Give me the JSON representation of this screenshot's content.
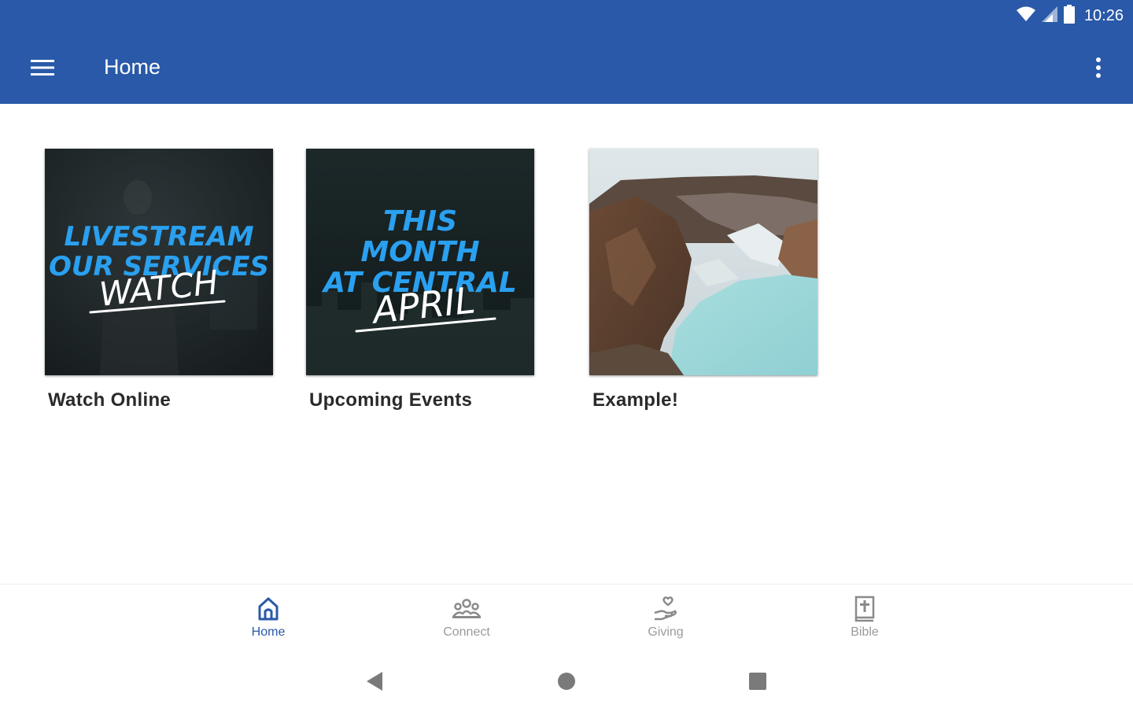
{
  "status_bar": {
    "time": "10:26",
    "icons": [
      "wifi-icon",
      "cell-signal-icon",
      "battery-icon"
    ]
  },
  "app_bar": {
    "title": "Home",
    "menu_icon": "hamburger-menu-icon",
    "overflow_icon": "more-vertical-icon"
  },
  "tiles": [
    {
      "label": "Watch Online",
      "image_text": [
        "LIVESTREAM",
        "OUR SERVICES",
        "WATCH"
      ]
    },
    {
      "label": "Upcoming Events",
      "image_text": [
        "THIS",
        "MONTH",
        "AT CENTRAL",
        "APRIL"
      ]
    },
    {
      "label": "Example!",
      "image_text": []
    }
  ],
  "bottom_nav": {
    "items": [
      {
        "label": "Home",
        "icon": "home-icon",
        "active": true
      },
      {
        "label": "Connect",
        "icon": "people-icon",
        "active": false
      },
      {
        "label": "Giving",
        "icon": "giving-hand-icon",
        "active": false
      },
      {
        "label": "Bible",
        "icon": "bible-icon",
        "active": false
      }
    ]
  },
  "system_nav": {
    "buttons": [
      "back-icon",
      "home-circle-icon",
      "recents-square-icon"
    ]
  },
  "colors": {
    "primary": "#2959a8",
    "active_nav": "#2959a8",
    "inactive_nav": "#9a9a9a",
    "tile_label": "#2a2a2a",
    "image_text_blue": "#2aa0f0"
  }
}
